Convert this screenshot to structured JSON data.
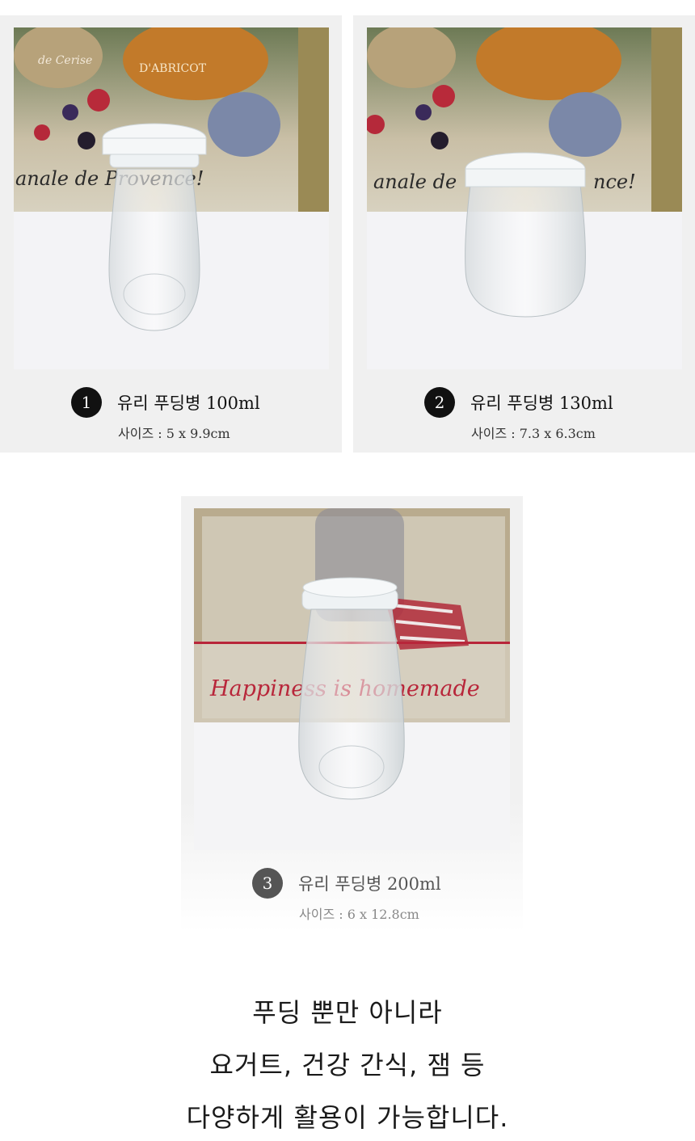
{
  "products": [
    {
      "number": "1",
      "title": "유리 푸딩병 100ml",
      "size": "사이즈 : 5 x 9.9cm",
      "image": "pudding-bottle-100ml-photo"
    },
    {
      "number": "2",
      "title": "유리 푸딩병 130ml",
      "size": "사이즈 : 7.3 x 6.3cm",
      "image": "pudding-jar-130ml-photo"
    },
    {
      "number": "3",
      "title": "유리 푸딩병 200ml",
      "size": "사이즈 : 6 x 12.8cm",
      "image": "pudding-bottle-200ml-photo"
    }
  ],
  "backdrop_text": {
    "sign1": "de Cerise",
    "sign2": "D'ABRICOT",
    "sign3": "anale de Provence!",
    "sign4": "Happiness is homemade"
  },
  "headline": {
    "line1": "푸딩 뿐만 아니라",
    "line2": "요거트, 건강 간식, 잼 등",
    "line3": "다양하게 활용이 가능합니다."
  },
  "colors": {
    "card_bg": "#f0f0f0",
    "badge": "#111111",
    "badge_muted": "#555555",
    "accent_red": "#b8263a"
  }
}
